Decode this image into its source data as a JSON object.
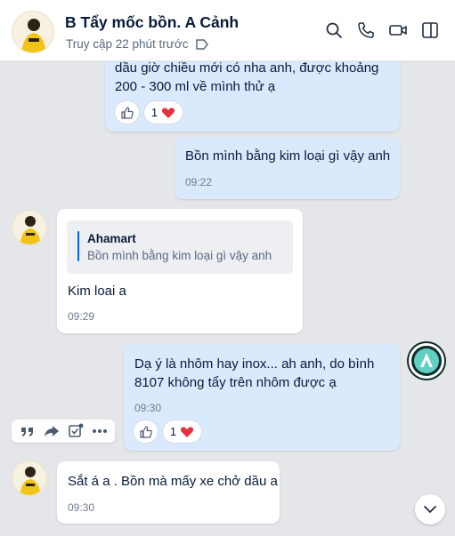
{
  "header": {
    "title": "B Tẩy mốc bồn. A Cảnh",
    "status": "Truy cập 22 phút trước",
    "icons": [
      "search-icon",
      "phone-icon",
      "video-icon",
      "sidebar-toggle-icon",
      "tag-icon"
    ]
  },
  "messages": [
    {
      "id": "m1",
      "side": "me",
      "text_line1": "dầu giờ chiều mới có nha anh, được khoảng",
      "text_line2": "200 - 300 ml về mình thử ạ",
      "reaction_count": "1"
    },
    {
      "id": "m2",
      "side": "me",
      "text": "Bồn mình bằng kim loại gì vậy anh",
      "time": "09:22"
    },
    {
      "id": "m3",
      "side": "them",
      "quote_author": "Ahamart",
      "quote_text": "Bồn mình bằng kim loại gì vậy anh",
      "text": "Kim loai a",
      "time": "09:29"
    },
    {
      "id": "m4",
      "side": "me",
      "text_line1": "Dạ ý là nhôm hay inox... ah anh, do bình",
      "text_line2": "8107 không tẩy trên nhôm được ạ",
      "time": "09:30",
      "reaction_count": "1"
    },
    {
      "id": "m5",
      "side": "them",
      "text": "Sắt á a . Bồn mà mấy xe chở dầu a",
      "time": "09:30"
    }
  ],
  "action_bar": [
    "quote-icon",
    "forward-icon",
    "task-icon",
    "more-icon"
  ],
  "colors": {
    "accent": "#0068ff",
    "my_bubble": "#dbe9fd",
    "their_bubble": "#ffffff",
    "background": "#e4e6e9",
    "heart": "#e5303f"
  }
}
